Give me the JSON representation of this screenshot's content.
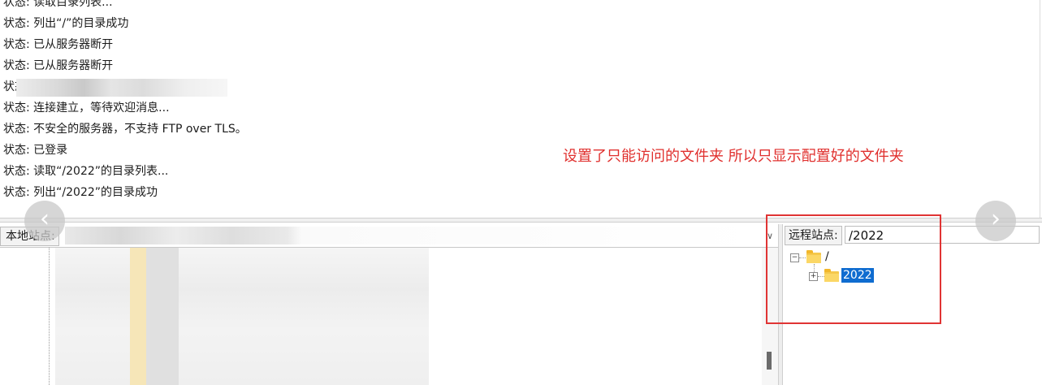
{
  "log": {
    "lines": [
      "状态:\t读取目录列表...",
      "状态:\t列出“/”的目录成功",
      "状态:\t已从服务器断开",
      "状态:\t已从服务器断开",
      "状态:",
      "状态:\t连接建立，等待欢迎消息...",
      "状态:\t不安全的服务器，不支持 FTP over TLS。",
      "状态:\t已登录",
      "状态:\t读取“/2022”的目录列表...",
      "状态:\t列出“/2022”的目录成功"
    ]
  },
  "annotation": "设置了只能访问的文件夹 所以只显示配置好的文件夹",
  "nav": {
    "prev_icon": "chevron-left-icon",
    "next_icon": "chevron-right-icon"
  },
  "local": {
    "label": "本地站点:",
    "dropdown_icon": "chevron-down-icon"
  },
  "remote": {
    "label": "远程站点:",
    "path": "/2022",
    "tree": {
      "root_label": "/",
      "root_toggle": "⊟",
      "child_label": "2022",
      "child_toggle": "⊞"
    }
  },
  "colors": {
    "annotation": "#e0302e",
    "highlight_box": "#e03434",
    "selection": "#0f6cd0",
    "folder": "#f5c84c"
  }
}
